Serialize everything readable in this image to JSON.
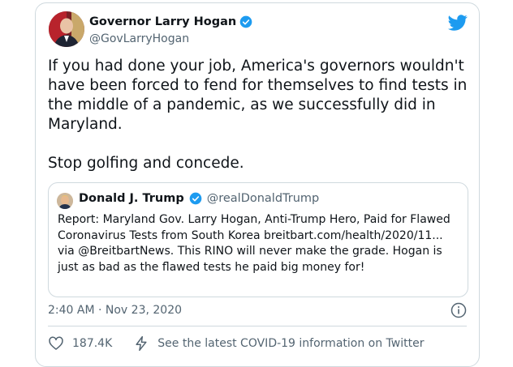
{
  "tweet": {
    "author": {
      "name": "Governor Larry Hogan",
      "handle": "@GovLarryHogan"
    },
    "paragraphs": [
      "If you had done your job, America's governors wouldn't have been forced to fend for themselves to find tests in the middle of a pandemic, as we successfully did in Maryland.",
      "Stop golfing and concede."
    ],
    "quoted": {
      "name": "Donald J. Trump",
      "handle": "@realDonaldTrump",
      "text": "Report: Maryland Gov. Larry Hogan, Anti-Trump Hero, Paid for Flawed Coronavirus Tests from South Korea breitbart.com/health/2020/11... via @BreitbartNews. This RINO will never make the grade. Hogan is just as bad as the flawed tests he paid big money for!"
    },
    "timestamp": "2:40 AM · Nov 23, 2020",
    "likes": "187.4K",
    "covid_link": "See the latest COVID-19 information on Twitter"
  },
  "icons": {
    "brand": "twitter-bird-icon",
    "verified": "verified-badge-icon",
    "info": "info-icon",
    "like": "heart-icon",
    "covid": "lightning-icon"
  },
  "colors": {
    "accent": "#1d9bf0",
    "text": "#0f1419",
    "secondary": "#536471",
    "border": "#cfd9de"
  }
}
